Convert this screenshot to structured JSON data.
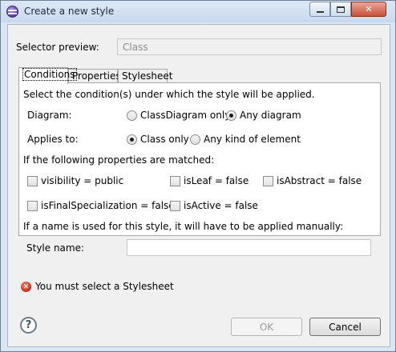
{
  "window": {
    "title": "Create a new style"
  },
  "selector": {
    "label": "Selector preview:",
    "value": "Class"
  },
  "tabs": [
    "Conditions",
    "Properties",
    "Stylesheet"
  ],
  "conditions": {
    "intro": "Select the condition(s) under which the style will be applied.",
    "diagram_label": "Diagram:",
    "diagram_options": [
      "ClassDiagram only",
      "Any diagram"
    ],
    "diagram_selected": "Any diagram",
    "applies_label": "Applies to:",
    "applies_options": [
      "Class only",
      "Any kind of element"
    ],
    "applies_selected": "Class only",
    "props_intro": "If the following properties are matched:",
    "properties": [
      "visibility = public",
      "isLeaf = false",
      "isAbstract = false",
      "isFinalSpecialization = false",
      "isActive = false"
    ],
    "name_intro": "If a name is used for this style, it will have to be applied manually:",
    "style_name_label": "Style name:",
    "style_name_value": ""
  },
  "error": {
    "message": "You must select a Stylesheet",
    "icon": "error-icon"
  },
  "buttons": {
    "ok": "OK",
    "cancel": "Cancel",
    "help": "?"
  }
}
